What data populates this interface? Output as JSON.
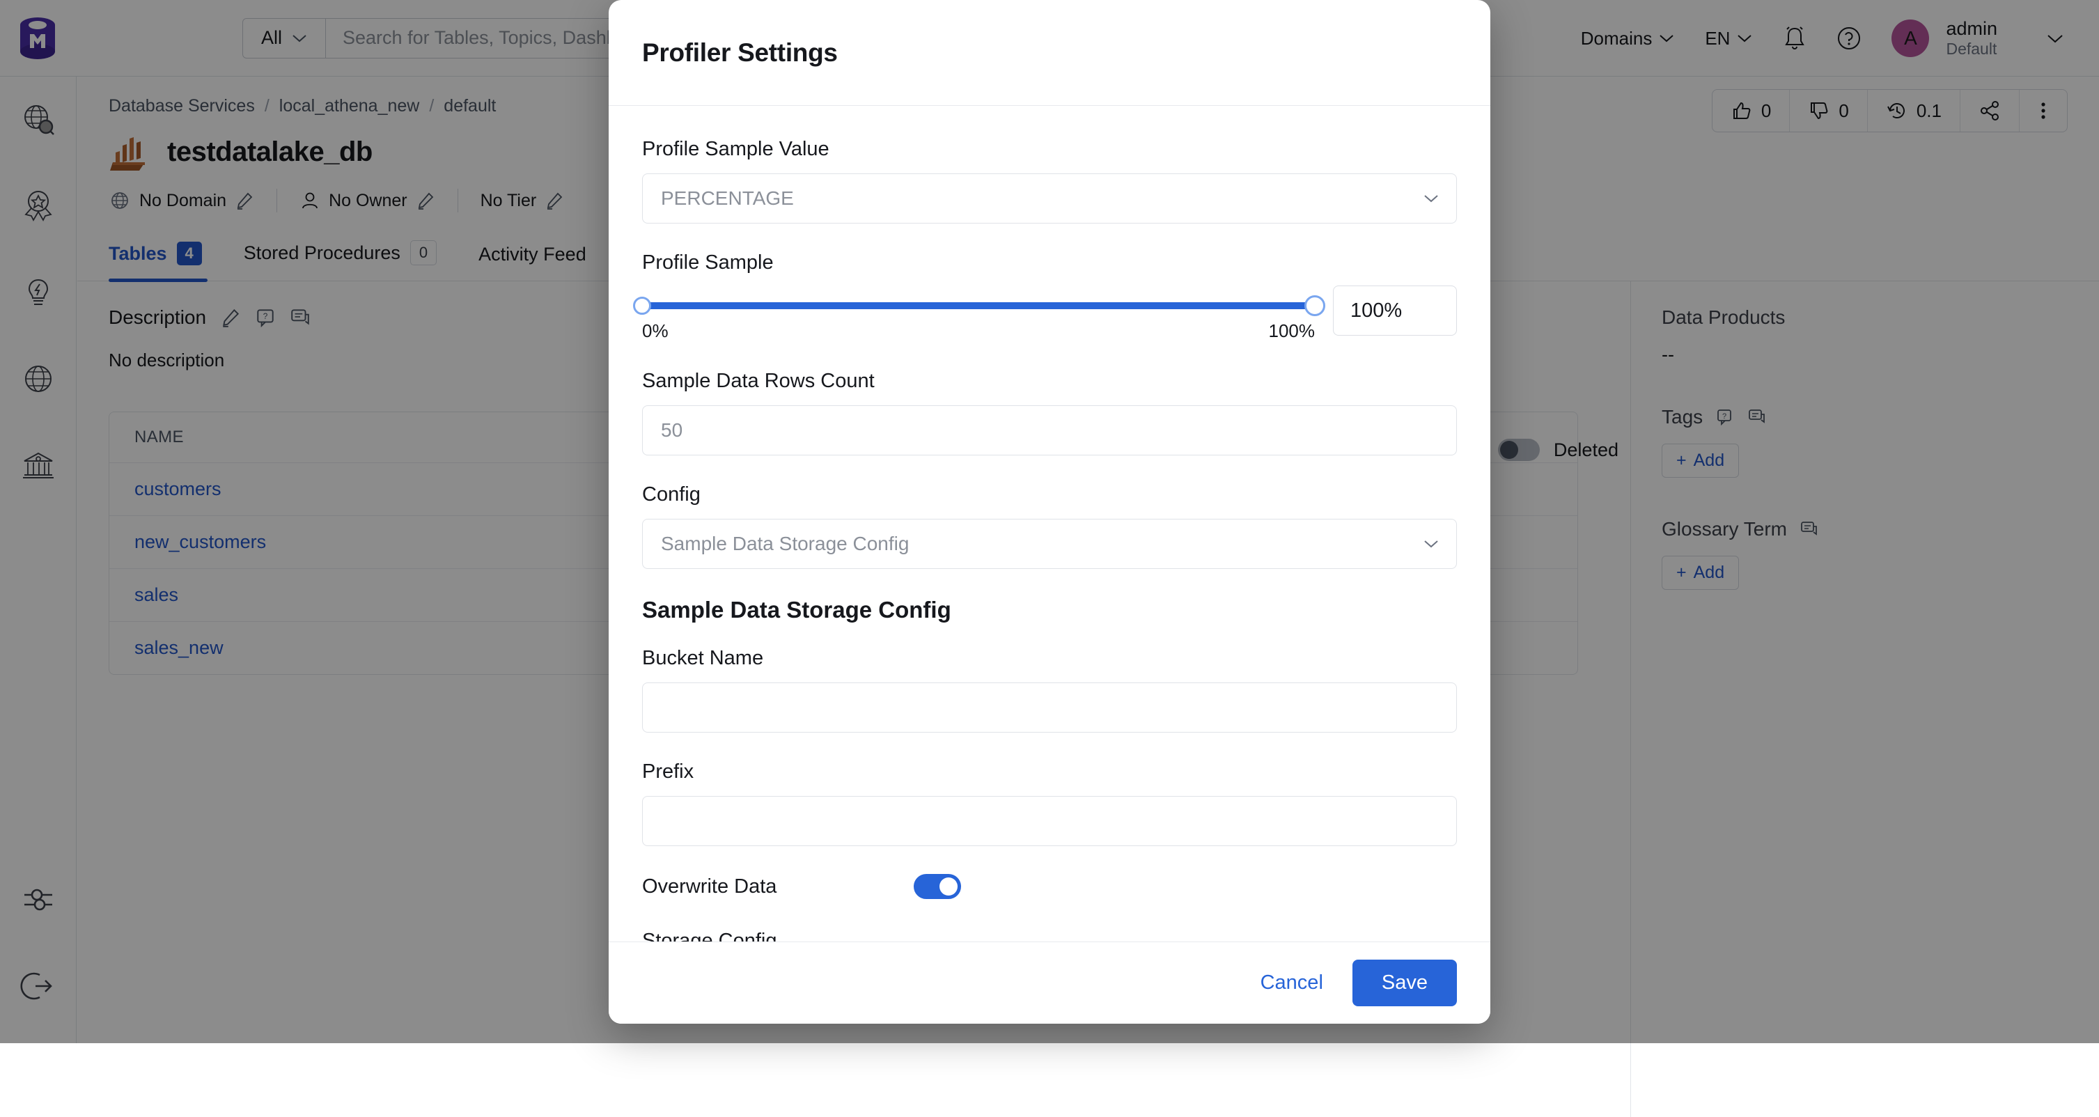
{
  "header": {
    "search_scope": "All",
    "search_placeholder": "Search for Tables, Topics, Dashboards",
    "domains_label": "Domains",
    "language": "EN",
    "user_name": "admin",
    "user_role": "Default",
    "avatar_initial": "A",
    "avatar_color": "#b5559b"
  },
  "sidebar": {
    "items": [
      {
        "name": "explore-icon",
        "label": "Explore"
      },
      {
        "name": "quality-icon",
        "label": "Observability"
      },
      {
        "name": "insights-icon",
        "label": "Insights"
      },
      {
        "name": "domains-icon",
        "label": "Domains"
      },
      {
        "name": "govern-icon",
        "label": "Govern"
      }
    ],
    "bottom_items": [
      {
        "name": "settings-icon",
        "label": "Settings"
      },
      {
        "name": "logout-icon",
        "label": "Logout"
      }
    ]
  },
  "breadcrumb": [
    "Database Services",
    "local_athena_new",
    "default"
  ],
  "entity": {
    "title": "testdatalake_db",
    "domain": "No Domain",
    "owner": "No Owner",
    "tier": "No Tier"
  },
  "actions": {
    "thumbs_up_count": "0",
    "thumbs_down_count": "0",
    "version": "0.1"
  },
  "tabs": [
    {
      "label": "Tables",
      "count": "4",
      "active": true
    },
    {
      "label": "Stored Procedures",
      "count": "0",
      "active": false
    },
    {
      "label": "Activity Feed",
      "count": "",
      "active": false
    }
  ],
  "description": {
    "heading": "Description",
    "body": "No description"
  },
  "table": {
    "columns": [
      "NAME"
    ],
    "rows": [
      "customers",
      "new_customers",
      "sales",
      "sales_new"
    ]
  },
  "filters": {
    "deleted_label": "Deleted",
    "deleted_on": false
  },
  "right_panel": {
    "data_products_title": "Data Products",
    "data_products_value": "--",
    "tags_title": "Tags",
    "tags_add_label": "Add",
    "glossary_title": "Glossary Term",
    "glossary_add_label": "Add"
  },
  "modal": {
    "title": "Profiler Settings",
    "profile_sample_value": {
      "label": "Profile Sample Value",
      "value": "PERCENTAGE"
    },
    "profile_sample": {
      "label": "Profile Sample",
      "min_label": "0%",
      "max_label": "100%",
      "value": "100%",
      "percent": 100
    },
    "sample_rows": {
      "label": "Sample Data Rows Count",
      "value": "50"
    },
    "config": {
      "label": "Config",
      "value": "Sample Data Storage Config"
    },
    "storage_section": {
      "title": "Sample Data Storage Config",
      "bucket_label": "Bucket Name",
      "bucket_value": "",
      "prefix_label": "Prefix",
      "prefix_value": "",
      "overwrite_label": "Overwrite Data",
      "overwrite_on": true,
      "storage_config_label": "Storage Config",
      "storage_config_value": ""
    },
    "cancel_label": "Cancel",
    "save_label": "Save",
    "accent_color": "#2764d8"
  }
}
